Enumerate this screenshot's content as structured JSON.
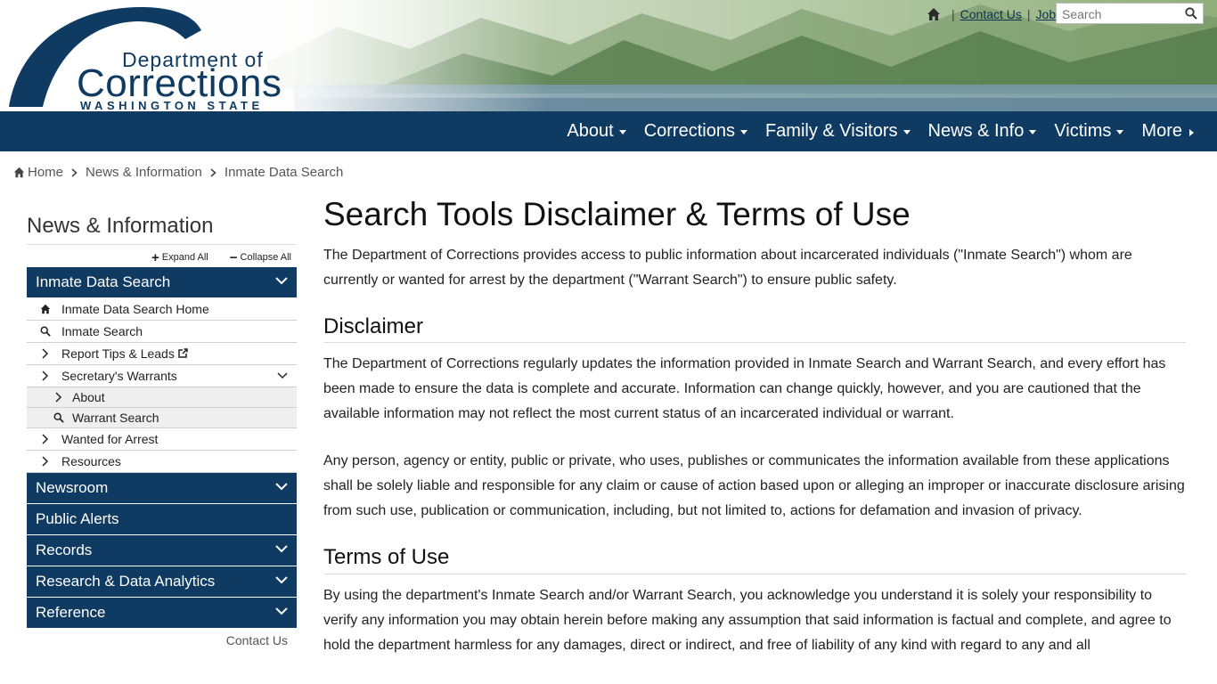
{
  "logo": {
    "line1": "Department of",
    "line2": "Corrections",
    "line3": "WASHINGTON STATE"
  },
  "utility": {
    "contact": "Contact Us",
    "jobs": "Jobs",
    "sep": "|",
    "search_placeholder": "Search"
  },
  "nav": {
    "items": [
      "About",
      "Corrections",
      "Family & Visitors",
      "News & Info",
      "Victims",
      "More"
    ]
  },
  "breadcrumb": [
    "Home",
    "News & Information",
    "Inmate Data Search"
  ],
  "sidebar": {
    "title": "News & Information",
    "expand_all": "Expand All",
    "collapse_all": "Collapse All",
    "active_section": "Inmate Data Search",
    "sub_items": [
      "Inmate Data Search Home",
      "Inmate Search",
      "Report Tips & Leads",
      "Secretary's Warrants",
      "Wanted for Arrest",
      "Resources"
    ],
    "child_items": [
      "About",
      "Warrant Search"
    ],
    "sections": [
      "Newsroom",
      "Public Alerts",
      "Records",
      "Research & Data Analytics",
      "Reference"
    ],
    "contact": "Contact Us"
  },
  "main": {
    "title": "Search Tools Disclaimer & Terms of Use",
    "intro": "The Department of Corrections provides access to public information about incarcerated individuals (\"Inmate Search\") whom are currently or wanted for arrest by the department (\"Warrant Search\") to ensure public safety.",
    "disclaimer_heading": "Disclaimer",
    "disclaimer_p1": "The Department of Corrections regularly updates the information provided in Inmate Search and Warrant Search, and every effort has been made to ensure the data is complete and accurate. Information can change quickly, however, and you are cautioned that the available information may not reflect the most current status of an incarcerated individual or warrant.",
    "disclaimer_p2": "Any person, agency or entity, public or private, who uses, publishes or communicates the information available from these applications shall be solely liable and responsible for any claim or cause of action based upon or alleging an improper or inaccurate disclosure arising from such use, publication or communication, including, but not limited to, actions for defamation and invasion of privacy.",
    "terms_heading": "Terms of Use",
    "terms_p1": "By using the department's Inmate Search and/or Warrant Search, you acknowledge you understand it is solely your responsibility to verify any information you may obtain herein before making any assumption that said information is factual and complete, and agree to hold the department harmless for any damages, direct or indirect, and free of liability of any kind with regard to any and all"
  },
  "colors": {
    "brand_navy": "#0f3a62"
  }
}
